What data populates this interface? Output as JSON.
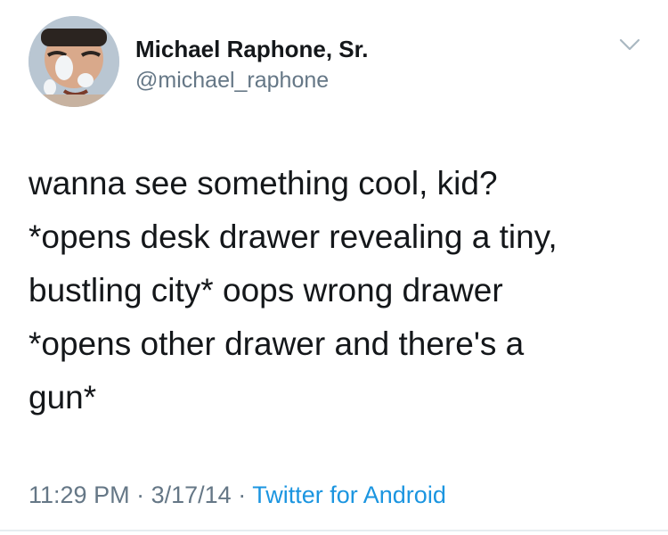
{
  "tweet": {
    "author": {
      "display_name": "Michael Raphone, Sr.",
      "handle": "@michael_raphone",
      "avatar_icon": "user-avatar-photo"
    },
    "menu_icon": "chevron-down-icon",
    "text": "wanna see something cool, kid?\n*opens desk drawer revealing a tiny,\nbustling city* oops wrong drawer\n*opens other drawer and there's a\ngun*",
    "time": "11:29 PM",
    "separator": "·",
    "date": "3/17/14",
    "source": "Twitter for Android",
    "colors": {
      "primary_text": "#14171a",
      "secondary_text": "#657786",
      "link": "#1b95e0"
    }
  }
}
